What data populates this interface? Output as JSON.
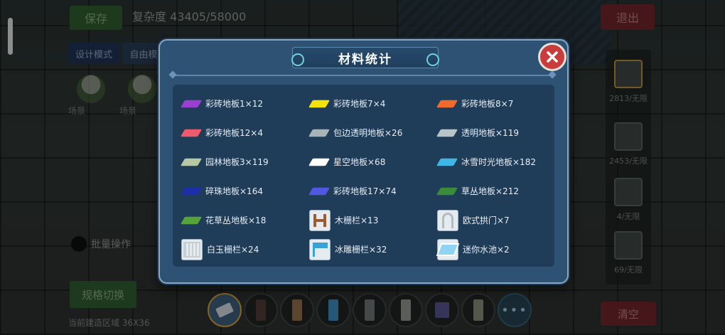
{
  "hud": {
    "save_label": "保存",
    "complexity": "复杂度 43405/58000",
    "exit_label": "退出",
    "mode_design": "设计模式",
    "mode_free": "自由模",
    "scene_1": "场景",
    "scene_2": "场景",
    "bulk_label": "批量操作",
    "switch_label": "规格切换",
    "size_text": "当前建造区域 36X36",
    "clear_label": "清空"
  },
  "side_panel": [
    {
      "icon": "floor-icon",
      "count": "2813/无限"
    },
    {
      "icon": "wall-icon",
      "count": "2453/无限"
    },
    {
      "icon": "door-icon",
      "count": "4/无限"
    },
    {
      "icon": "fence-icon",
      "count": "69/无限"
    }
  ],
  "hotbar": [
    {
      "icon": "eraser-icon",
      "color": "#c9d0d6"
    },
    {
      "icon": "dark-block-icon",
      "color": "#4a3a34"
    },
    {
      "icon": "wood-block-icon",
      "color": "#8a6a47"
    },
    {
      "icon": "water-block-icon",
      "color": "#3b86b5"
    },
    {
      "icon": "stone-block-icon",
      "color": "#6b6f71"
    },
    {
      "icon": "pillar-block-icon",
      "color": "#8d9187"
    },
    {
      "icon": "window-block-icon",
      "color": "#55508a"
    },
    {
      "icon": "plank-block-icon",
      "color": "#7f8874"
    }
  ],
  "dialog": {
    "title": "材料统计",
    "items": [
      {
        "label": "彩砖地板1×12",
        "icon": "purple-floor-tile-icon",
        "color": "#9b3fd3"
      },
      {
        "label": "彩砖地板7×4",
        "icon": "yellow-floor-tile-icon",
        "color": "#f4e20b"
      },
      {
        "label": "彩砖地板8×7",
        "icon": "orange-floor-tile-icon",
        "color": "#f06a2b"
      },
      {
        "label": "彩砖地板12×4",
        "icon": "pink-floor-tile-icon",
        "color": "#ef5a6c"
      },
      {
        "label": "包边透明地板×26",
        "icon": "glass-floor-tile-icon",
        "color": "#a7b3b6"
      },
      {
        "label": "透明地板×119",
        "icon": "clear-floor-tile-icon",
        "color": "#b9c4c8"
      },
      {
        "label": "园林地板3×119",
        "icon": "garden-floor-tile-icon",
        "color": "#b7c9a2"
      },
      {
        "label": "星空地板×68",
        "icon": "starry-floor-tile-icon",
        "color": "#ffffff"
      },
      {
        "label": "冰雪时光地板×182",
        "icon": "ice-floor-tile-icon",
        "color": "#3fb7e6"
      },
      {
        "label": "碎珠地板×164",
        "icon": "bead-floor-tile-icon",
        "color": "#1c2ea8"
      },
      {
        "label": "彩砖地板17×74",
        "icon": "blue-purple-floor-tile-icon",
        "color": "#5257df"
      },
      {
        "label": "草丛地板×212",
        "icon": "grass-floor-tile-icon",
        "color": "#3a8b3a"
      },
      {
        "label": "花草丛地板×18",
        "icon": "flower-grass-tile-icon",
        "color": "#55a33a"
      },
      {
        "label": "木栅栏×13",
        "icon": "wood-fence-icon",
        "color": "#9b5b33"
      },
      {
        "label": "欧式拱门×7",
        "icon": "arch-door-icon",
        "color": "#b3bcc2"
      },
      {
        "label": "白玉栅栏×24",
        "icon": "jade-fence-icon",
        "color": "#e8eceb"
      },
      {
        "label": "冰雕栅栏×32",
        "icon": "ice-fence-icon",
        "color": "#3aa3d6"
      },
      {
        "label": "迷你水池×2",
        "icon": "mini-pool-icon",
        "color": "#8fd4f2"
      }
    ]
  }
}
